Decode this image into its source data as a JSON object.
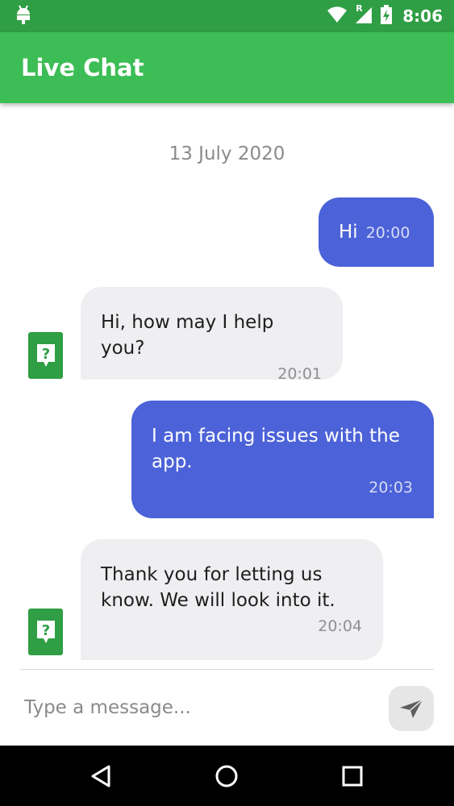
{
  "status_bar": {
    "time": "8:06",
    "icons": [
      "android-icon",
      "wifi-icon",
      "cell-signal-icon",
      "battery-charging-icon"
    ],
    "roaming_label": "R"
  },
  "app_bar": {
    "title": "Live Chat"
  },
  "chat": {
    "date": "13 July 2020",
    "messages": [
      {
        "direction": "outgoing",
        "text": "Hi",
        "time": "20:00"
      },
      {
        "direction": "incoming",
        "text": "Hi, how may I help you?",
        "time": "20:01"
      },
      {
        "direction": "outgoing",
        "text": "I am facing issues with the app.",
        "time": "20:03"
      },
      {
        "direction": "incoming",
        "text": "Thank you for letting us know. We will look into it.",
        "time": "20:04"
      }
    ]
  },
  "composer": {
    "placeholder": "Type a message..."
  },
  "colors": {
    "status_bar": "#2f9e44",
    "app_bar": "#3cbd55",
    "outgoing_bubble": "#4c62d8",
    "incoming_bubble": "#efeef1"
  },
  "nav_icons": [
    "back-icon",
    "home-icon",
    "recents-icon"
  ]
}
